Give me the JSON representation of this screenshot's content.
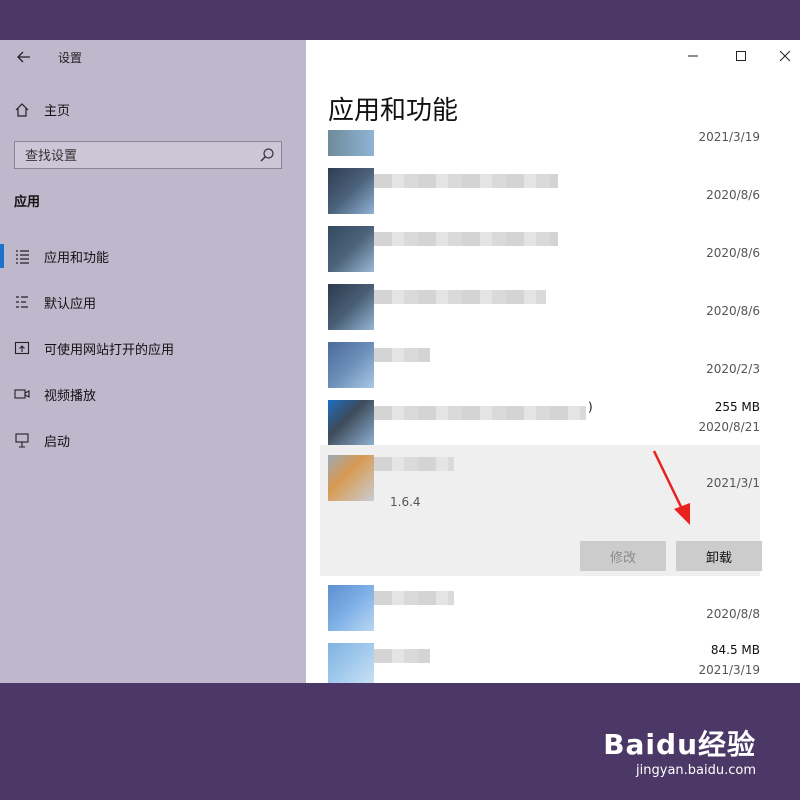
{
  "window": {
    "title": "设置",
    "back_icon": "back-arrow-icon"
  },
  "sidebar": {
    "home_label": "主页",
    "search_placeholder": "查找设置",
    "section_title": "应用",
    "items": [
      {
        "label": "应用和功能",
        "icon": "list-icon",
        "active": true
      },
      {
        "label": "默认应用",
        "icon": "default-apps-icon",
        "active": false
      },
      {
        "label": "可使用网站打开的应用",
        "icon": "open-website-icon",
        "active": false
      },
      {
        "label": "视频播放",
        "icon": "video-icon",
        "active": false
      },
      {
        "label": "启动",
        "icon": "startup-icon",
        "active": false
      }
    ]
  },
  "main": {
    "title": "应用和功能",
    "apps": [
      {
        "size": "",
        "date": "2021/3/19"
      },
      {
        "size": "",
        "date": "2020/8/6"
      },
      {
        "size": "",
        "date": "2020/8/6"
      },
      {
        "size": "",
        "date": "2020/8/6"
      },
      {
        "size": "",
        "date": "2020/2/3"
      },
      {
        "name_suffix": ")",
        "size": "255 MB",
        "date": "2020/8/21"
      },
      {
        "size": "",
        "date": "2021/3/1",
        "version": "1.6.4",
        "modify_label": "修改",
        "uninstall_label": "卸载"
      },
      {
        "size": "",
        "date": "2020/8/8"
      },
      {
        "size": "84.5 MB",
        "date": "2021/3/19"
      }
    ]
  },
  "colors": {
    "accent": "#1a73c8",
    "sidebar_bg": "#bfb7cc",
    "desktop_bg": "#4b3866",
    "arrow": "#e8231f"
  },
  "watermark": {
    "logo": "Baidu经验",
    "url": "jingyan.baidu.com"
  }
}
